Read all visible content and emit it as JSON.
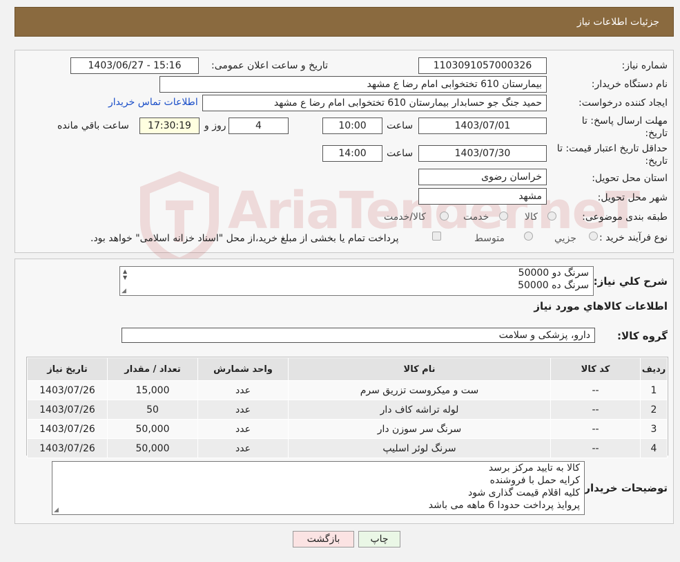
{
  "header": {
    "title": "جزئیات اطلاعات نیاز"
  },
  "form": {
    "need_number_label": "شماره نیاز:",
    "need_number": "1103091057000326",
    "announce_label": "تاریخ و ساعت اعلان عمومی:",
    "announce_value": "1403/06/27 - 15:16",
    "buyer_org_label": "نام دستگاه خریدار:",
    "buyer_org": "بیمارستان 610 تختخوابی امام رضا ع  مشهد",
    "requester_label": "ایجاد کننده درخواست:",
    "requester": "حمید جنگ جو حسابدار بیمارستان 610 تختخوابی امام رضا ع  مشهد",
    "contact_link": "اطلاعات تماس خریدار",
    "deadline_label": "مهلت ارسال پاسخ: تا تاریخ:",
    "deadline_date": "1403/07/01",
    "time_word": "ساعت",
    "deadline_time": "10:00",
    "days_value": "4",
    "days_word": "روز و",
    "remaining_time": "17:30:19",
    "remaining_word": "ساعت باقي مانده",
    "price_validity_label": "حداقل تاریخ اعتبار قیمت: تا تاریخ:",
    "price_validity_date": "1403/07/30",
    "price_validity_time": "14:00",
    "province_label": "استان محل تحویل:",
    "province": "خراسان رضوی",
    "city_label": "شهر محل تحویل:",
    "city": "مشهد",
    "category_label": "طبقه بندی موضوعی:",
    "category_options": [
      "کالا",
      "خدمت",
      "کالا/خدمت"
    ],
    "process_label": "نوع فرآیند خرید :",
    "process_options": [
      "جزیي",
      "متوسط"
    ],
    "process_note": "پرداخت تمام یا بخشی از مبلغ خرید،از محل \"اسناد خزانه اسلامی\" خواهد بود."
  },
  "summary": {
    "label": "شرح کلي نياز:",
    "lines": [
      "سرنگ دو 50000",
      "سرنگ ده 50000"
    ],
    "goods_info_title": "اطلاعات کالاهاي مورد نياز",
    "group_label": "گروه کالا:",
    "group_value": "دارو، پزشکی و سلامت"
  },
  "table": {
    "headers": [
      "ردیف",
      "کد کالا",
      "نام کالا",
      "واحد شمارش",
      "تعداد / مقدار",
      "تاریخ نیاز"
    ],
    "rows": [
      [
        "1",
        "--",
        "ست و میکروست تزریق سرم",
        "عدد",
        "15,000",
        "1403/07/26"
      ],
      [
        "2",
        "--",
        "لوله تراشه کاف دار",
        "عدد",
        "50",
        "1403/07/26"
      ],
      [
        "3",
        "--",
        "سرنگ سر سوزن دار",
        "عدد",
        "50,000",
        "1403/07/26"
      ],
      [
        "4",
        "--",
        "سرنگ لوئر اسلیپ",
        "عدد",
        "50,000",
        "1403/07/26"
      ]
    ]
  },
  "buyer_notes": {
    "label": "توضیحات خریدار:",
    "lines": [
      "کالا به تایید مرکز برسد",
      "کرایه حمل با فروشنده",
      "کلیه اقلام قیمت گذاری شود",
      "پروایذ پرداخت حدودا 6 ماهه می باشد"
    ]
  },
  "buttons": {
    "print": "چاپ",
    "back": "بازگشت"
  },
  "watermark": {
    "text": "AriaTender.neT"
  },
  "colors": {
    "header_bg": "#8a6a3f",
    "link": "#1a4ec8",
    "print_btn": "#eaf7e6",
    "back_btn": "#fbe3e3"
  }
}
